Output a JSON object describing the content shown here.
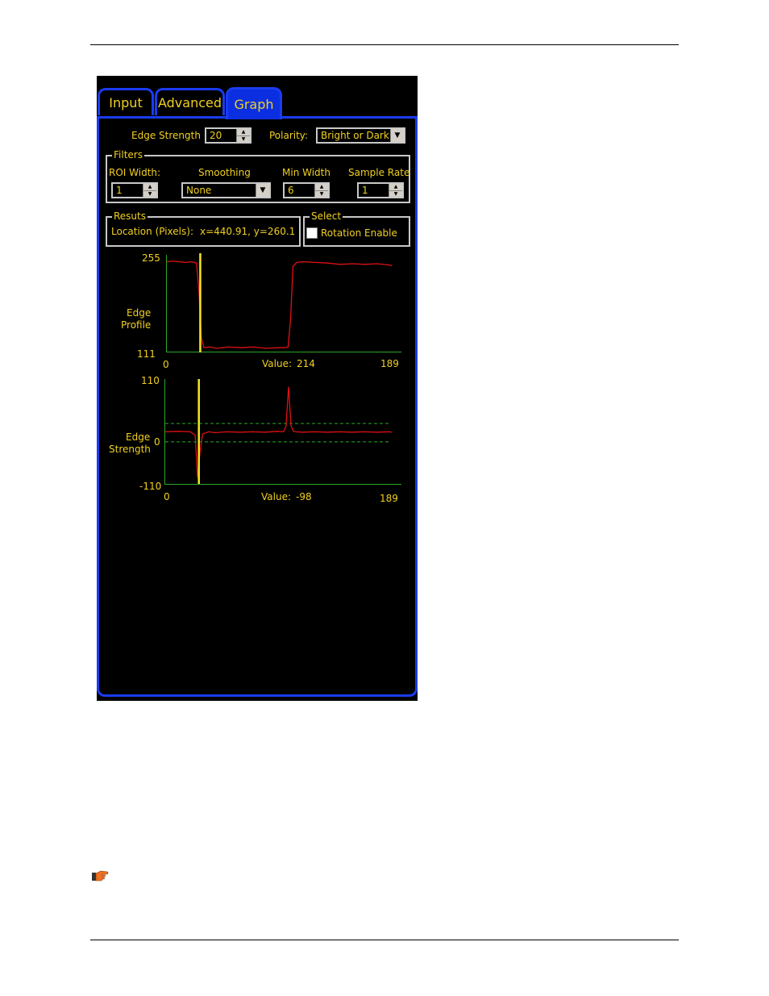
{
  "tabs": [
    {
      "label": "Input",
      "active": false
    },
    {
      "label": "Advanced",
      "active": false
    },
    {
      "label": "Graph",
      "active": true
    }
  ],
  "controls": {
    "edge_strength_label": "Edge Strength",
    "edge_strength_value": "20",
    "polarity_label": "Polarity:",
    "polarity_value": "Bright or Dark"
  },
  "filters": {
    "title": "Filters",
    "roi_width_label": "ROI Width:",
    "roi_width_value": "1",
    "smoothing_label": "Smoothing",
    "smoothing_value": "None",
    "min_width_label": "Min Width",
    "min_width_value": "6",
    "sample_rate_label": "Sample Rate",
    "sample_rate_value": "1"
  },
  "results": {
    "title": "Resuts",
    "location_label": "Location (Pixels):",
    "location_value": "x=440.91, y=260.1¹"
  },
  "select": {
    "title": "Select",
    "rotation_enable_label": "Rotation Enable",
    "rotation_enable_checked": false
  },
  "edge_profile": {
    "ylabel_line1": "Edge",
    "ylabel_line2": "Profile",
    "ymax": "255",
    "ymin": "111",
    "xmin": "0",
    "xmax": "189",
    "value_label": "Value:",
    "value": "214"
  },
  "edge_strength_graph": {
    "ylabel_line1": "Edge",
    "ylabel_line2": "Strength",
    "ymax": "110",
    "yzero": "0",
    "ymin": "-110",
    "xmin": "0",
    "xmax": "189",
    "value_label": "Value:",
    "value": "-98"
  },
  "colors": {
    "accent_blue": "#1a3cf0",
    "text_yellow": "#f0d020",
    "trace_red": "#e01010",
    "axis_green": "#2aa82a",
    "cursor_yellow": "#f5e61e"
  },
  "chart_data": [
    {
      "type": "line",
      "ylabel": "Edge Profile",
      "xlim": [
        0,
        189
      ],
      "ylim": [
        111,
        255
      ],
      "cursor_x": 27,
      "series": [
        {
          "x": [
            0,
            5,
            10,
            15,
            20,
            24,
            26,
            28,
            30,
            35,
            40,
            50,
            60,
            70,
            80,
            90,
            95,
            98,
            100,
            102,
            105,
            110,
            120,
            130,
            140,
            150,
            160,
            170,
            180,
            182
          ],
          "values": [
            247,
            248,
            247,
            246,
            247,
            245,
            200,
            130,
            117,
            118,
            116,
            118,
            117,
            118,
            116,
            117,
            117,
            118,
            160,
            240,
            246,
            247,
            246,
            245,
            243,
            244,
            243,
            244,
            242,
            241
          ]
        }
      ]
    },
    {
      "type": "line",
      "ylabel": "Edge Strength",
      "xlim": [
        0,
        189
      ],
      "ylim": [
        -110,
        110
      ],
      "cursor_x": 27,
      "threshold_lines": [
        20,
        -20
      ],
      "series": [
        {
          "x": [
            0,
            10,
            20,
            24,
            26,
            28,
            30,
            35,
            40,
            50,
            60,
            70,
            80,
            90,
            95,
            97,
            99,
            101,
            103,
            105,
            110,
            120,
            130,
            140,
            150,
            160,
            170,
            180,
            182
          ],
          "values": [
            2,
            3,
            2,
            -5,
            -98,
            -40,
            -3,
            2,
            0,
            2,
            1,
            2,
            1,
            3,
            2,
            15,
            100,
            15,
            3,
            2,
            1,
            2,
            1,
            2,
            1,
            2,
            1,
            2,
            1
          ]
        }
      ]
    }
  ]
}
